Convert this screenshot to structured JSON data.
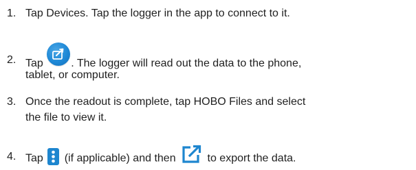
{
  "steps": [
    {
      "number": "1.",
      "line1": "Tap Devices. Tap the logger in the app to connect to it."
    },
    {
      "number": "2.",
      "before": "Tap",
      "after": ". The logger will read out the data to the phone,",
      "line2": "tablet, or computer.",
      "icon": "readout-button-icon"
    },
    {
      "number": "3.",
      "line1": "Once the readout is complete, tap HOBO Files and select",
      "line2": "the file to view it."
    },
    {
      "number": "4.",
      "before": "Tap",
      "middle": "(if applicable) and then",
      "after": "to export the data.",
      "icons": [
        "more-options-icon",
        "export-icon"
      ]
    }
  ],
  "colors": {
    "text": "#1f1f1f",
    "accent": "#1e88d6"
  }
}
